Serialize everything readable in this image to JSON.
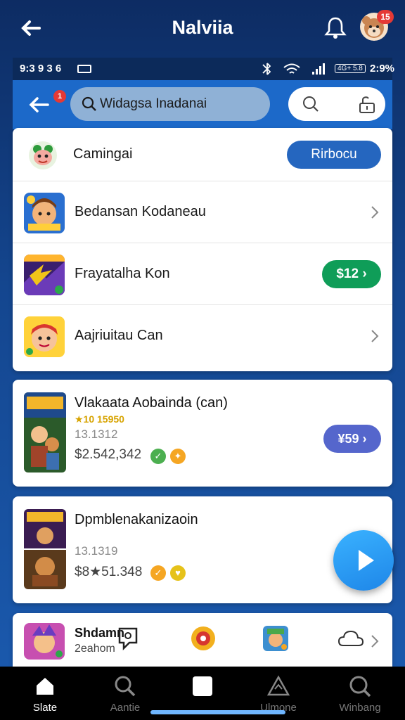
{
  "app": {
    "title": "Nalviia",
    "avatar_badge": "15"
  },
  "statusbar": {
    "time": "9:3 9 3 6",
    "network": "4G+ 5.8",
    "battery": "2:9%"
  },
  "search": {
    "placeholder": "Widagsa Inadanai",
    "value": "Widagsa Inadanai",
    "back_badge": "1"
  },
  "category": {
    "label": "Camingai",
    "button": "Rirbocu"
  },
  "list": [
    {
      "name": "Bedansan Kodaneau",
      "action": "chevron"
    },
    {
      "name": "Frayatalha Kon",
      "action": "price",
      "price": "$12 ›",
      "price_color": "#0f9d58"
    },
    {
      "name": "Aajriuitau Can",
      "action": "chevron"
    }
  ],
  "games": [
    {
      "title": "Vlakaata Aobainda (can)",
      "rating": "★10 15950",
      "sub1": "13.1312",
      "sub2": "$2.542,342",
      "price": "¥59 ›",
      "price_color": "#5566cc"
    },
    {
      "title": "Dpmblenakanizaoin",
      "rating": "",
      "sub1": "13.1319",
      "sub2": "$8★51.348",
      "price": "",
      "price_color": ""
    }
  ],
  "partial": {
    "title": "Shdamn",
    "sub": "2eahom"
  },
  "nav": [
    {
      "label": "Slate",
      "icon": "home-icon"
    },
    {
      "label": "Aantie",
      "icon": "search-icon"
    },
    {
      "label": "",
      "icon": "square-icon"
    },
    {
      "label": "Ulmone",
      "icon": "triangle-icon"
    },
    {
      "label": "Winbang",
      "icon": "search-icon"
    }
  ],
  "colors": {
    "accent": "#2566bf",
    "header": "#1c69c9",
    "green": "#0f9d58",
    "purple": "#5566cc",
    "fab": "#2a9cf5"
  }
}
